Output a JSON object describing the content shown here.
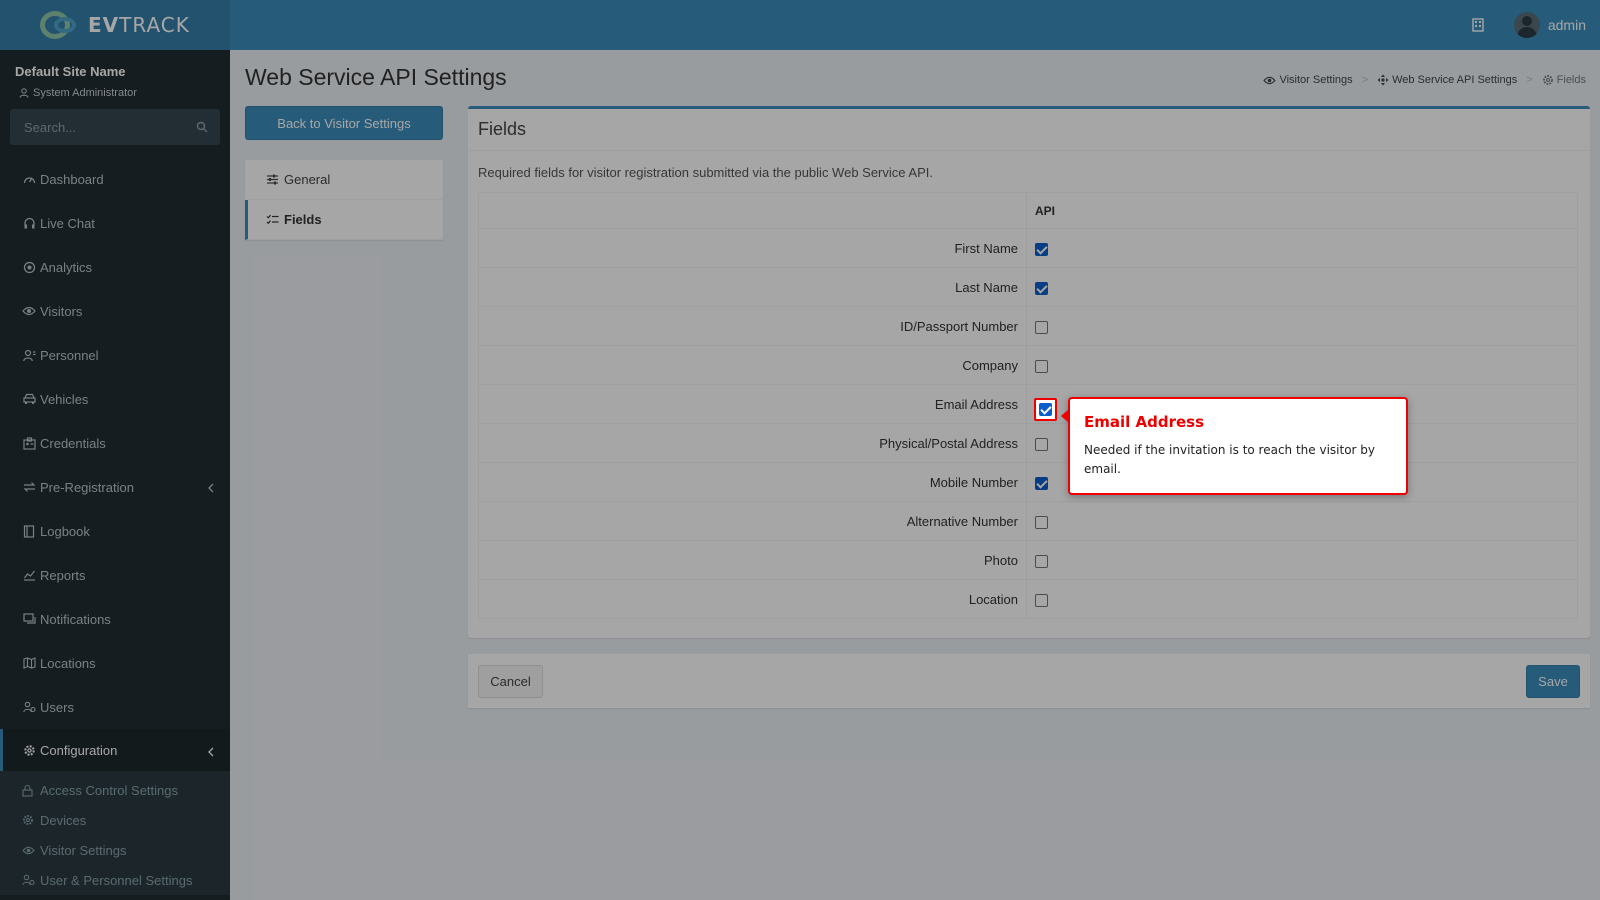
{
  "header": {
    "logo_text_bold": "EV",
    "logo_text_rest": "TRACK",
    "username": "admin"
  },
  "sidebar": {
    "site_name": "Default Site Name",
    "role": "System Administrator",
    "search_placeholder": "Search...",
    "items": [
      {
        "label": "Dashboard",
        "icon": "dashboard-icon"
      },
      {
        "label": "Live Chat",
        "icon": "headset-icon"
      },
      {
        "label": "Analytics",
        "icon": "target-icon"
      },
      {
        "label": "Visitors",
        "icon": "eye-icon"
      },
      {
        "label": "Personnel",
        "icon": "user-tie-icon"
      },
      {
        "label": "Vehicles",
        "icon": "car-icon"
      },
      {
        "label": "Credentials",
        "icon": "id-card-icon"
      },
      {
        "label": "Pre-Registration",
        "icon": "exchange-icon"
      },
      {
        "label": "Logbook",
        "icon": "book-icon"
      },
      {
        "label": "Reports",
        "icon": "chart-icon"
      },
      {
        "label": "Notifications",
        "icon": "message-icon"
      },
      {
        "label": "Locations",
        "icon": "map-icon"
      },
      {
        "label": "Users",
        "icon": "users-icon"
      },
      {
        "label": "Configuration",
        "icon": "cog-icon"
      }
    ],
    "submenu": [
      {
        "label": "Access Control Settings",
        "icon": "lock-icon"
      },
      {
        "label": "Devices",
        "icon": "gear-icon"
      },
      {
        "label": "Visitor Settings",
        "icon": "eye-icon"
      },
      {
        "label": "User & Personnel Settings",
        "icon": "users-icon"
      }
    ]
  },
  "page": {
    "title": "Web Service API Settings",
    "breadcrumb": [
      "Visitor Settings",
      "Web Service API Settings",
      "Fields"
    ],
    "back_button": "Back to Visitor Settings",
    "tabs": [
      "General",
      "Fields"
    ]
  },
  "fields_box": {
    "title": "Fields",
    "description": "Required fields for visitor registration submitted via the public Web Service API.",
    "column_header": "API",
    "rows": [
      {
        "label": "First Name",
        "checked": true
      },
      {
        "label": "Last Name",
        "checked": true
      },
      {
        "label": "ID/Passport Number",
        "checked": false
      },
      {
        "label": "Company",
        "checked": false
      },
      {
        "label": "Email Address",
        "checked": true
      },
      {
        "label": "Physical/Postal Address",
        "checked": false
      },
      {
        "label": "Mobile Number",
        "checked": true
      },
      {
        "label": "Alternative Number",
        "checked": false
      },
      {
        "label": "Photo",
        "checked": false
      },
      {
        "label": "Location",
        "checked": false
      }
    ]
  },
  "footer": {
    "cancel": "Cancel",
    "save": "Save"
  },
  "tooltip": {
    "title": "Email Address",
    "body": "Needed if the invitation is to reach the visitor by email."
  },
  "colors": {
    "primary": "#3c8dbc",
    "sidebar_bg": "#222d32",
    "highlight": "#ee0000"
  }
}
